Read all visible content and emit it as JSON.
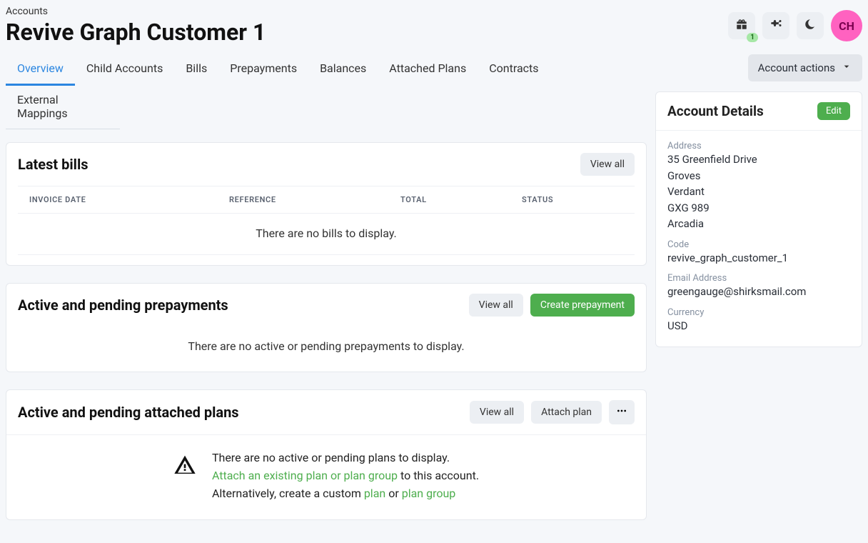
{
  "header": {
    "breadcrumb": "Accounts",
    "title": "Revive Graph Customer 1",
    "avatar_initials": "CH",
    "gift_badge": "1"
  },
  "tabs": [
    "Overview",
    "Child Accounts",
    "Bills",
    "Prepayments",
    "Balances",
    "Attached Plans",
    "Contracts",
    "External Mappings"
  ],
  "latest_bills": {
    "title": "Latest bills",
    "view_all": "View all",
    "columns": [
      "INVOICE DATE",
      "REFERENCE",
      "TOTAL",
      "STATUS"
    ],
    "empty": "There are no bills to display."
  },
  "prepayments": {
    "title": "Active and pending prepayments",
    "view_all": "View all",
    "create": "Create prepayment",
    "empty": "There are no active or pending prepayments to display."
  },
  "attached_plans": {
    "title": "Active and pending attached plans",
    "view_all": "View all",
    "attach": "Attach plan",
    "empty_line1": "There are no active or pending plans to display.",
    "attach_link": "Attach an existing plan or plan group",
    "attach_suffix": " to this account.",
    "alt_prefix": "Alternatively, create a custom ",
    "plan_link": "plan",
    "alt_or": " or ",
    "plan_group_link": "plan group"
  },
  "side": {
    "account_actions": "Account actions",
    "details_title": "Account Details",
    "edit": "Edit",
    "address_label": "Address",
    "address_lines": [
      "35 Greenfield Drive",
      "Groves",
      "Verdant",
      "GXG 989",
      "Arcadia"
    ],
    "code_label": "Code",
    "code": "revive_graph_customer_1",
    "email_label": "Email Address",
    "email": "greengauge@shirksmail.com",
    "currency_label": "Currency",
    "currency": "USD"
  }
}
